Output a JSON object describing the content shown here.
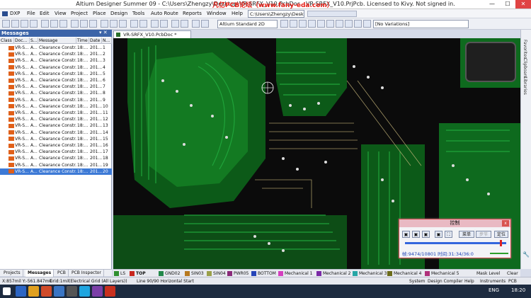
{
  "window": {
    "title": "Altium Designer Summer 09 - C:\\Users\\Zhengzy\\Desktop\\VR-SRFX_V10.PcbDoc - VR-SRFX_V10.PrjPcb. Licensed to Kivy. Not signed in.",
    "watermark": "凡亿PCB论坛（www.fany-eda.com）"
  },
  "menu": {
    "items": [
      "DXP",
      "File",
      "Edit",
      "View",
      "Project",
      "Place",
      "Design",
      "Tools",
      "Auto Route",
      "Reports",
      "Window",
      "Help"
    ],
    "path_combo": "C:\\Users\\Zhengzy\\Desktop\\VR-"
  },
  "toolbar": {
    "view_combo": "Altium Standard 2D",
    "variation_combo": "[No Variations]"
  },
  "messages": {
    "title": "Messages",
    "columns": [
      "Class",
      "Doc...",
      "S...",
      "Message",
      "Time",
      "Date",
      "N..."
    ],
    "rows": [
      {
        "doc": "VR-S...",
        "src": "A...",
        "msg": "Clearance Constr...",
        "time": "18:...",
        "date": "201...",
        "n": "1"
      },
      {
        "doc": "VR-S...",
        "src": "A...",
        "msg": "Clearance Constr...",
        "time": "18:...",
        "date": "201...",
        "n": "2"
      },
      {
        "doc": "VR-S...",
        "src": "A...",
        "msg": "Clearance Constr...",
        "time": "18:...",
        "date": "201...",
        "n": "3"
      },
      {
        "doc": "VR-S...",
        "src": "A...",
        "msg": "Clearance Constr...",
        "time": "18:...",
        "date": "201...",
        "n": "4"
      },
      {
        "doc": "VR-S...",
        "src": "A...",
        "msg": "Clearance Constr...",
        "time": "18:...",
        "date": "201...",
        "n": "5"
      },
      {
        "doc": "VR-S...",
        "src": "A...",
        "msg": "Clearance Constr...",
        "time": "18:...",
        "date": "201...",
        "n": "6"
      },
      {
        "doc": "VR-S...",
        "src": "A...",
        "msg": "Clearance Constr...",
        "time": "18:...",
        "date": "201...",
        "n": "7"
      },
      {
        "doc": "VR-S...",
        "src": "A...",
        "msg": "Clearance Constr...",
        "time": "18:...",
        "date": "201...",
        "n": "8"
      },
      {
        "doc": "VR-S...",
        "src": "A...",
        "msg": "Clearance Constr...",
        "time": "18:...",
        "date": "201...",
        "n": "9"
      },
      {
        "doc": "VR-S...",
        "src": "A...",
        "msg": "Clearance Constr...",
        "time": "18:...",
        "date": "201...",
        "n": "10"
      },
      {
        "doc": "VR-S...",
        "src": "A...",
        "msg": "Clearance Constr...",
        "time": "18:...",
        "date": "201...",
        "n": "11"
      },
      {
        "doc": "VR-S...",
        "src": "A...",
        "msg": "Clearance Constr...",
        "time": "18:...",
        "date": "201...",
        "n": "12"
      },
      {
        "doc": "VR-S...",
        "src": "A...",
        "msg": "Clearance Constr...",
        "time": "18:...",
        "date": "201...",
        "n": "13"
      },
      {
        "doc": "VR-S...",
        "src": "A...",
        "msg": "Clearance Constr...",
        "time": "18:...",
        "date": "201...",
        "n": "14"
      },
      {
        "doc": "VR-S...",
        "src": "A...",
        "msg": "Clearance Constr...",
        "time": "18:...",
        "date": "201...",
        "n": "15"
      },
      {
        "doc": "VR-S...",
        "src": "A...",
        "msg": "Clearance Constr...",
        "time": "18:...",
        "date": "201...",
        "n": "16"
      },
      {
        "doc": "VR-S...",
        "src": "A...",
        "msg": "Clearance Constr...",
        "time": "18:...",
        "date": "201...",
        "n": "17"
      },
      {
        "doc": "VR-S...",
        "src": "A...",
        "msg": "Clearance Constr...",
        "time": "18:...",
        "date": "201...",
        "n": "18"
      },
      {
        "doc": "VR-S...",
        "src": "A...",
        "msg": "Clearance Constr...",
        "time": "18:...",
        "date": "201...",
        "n": "19"
      },
      {
        "doc": "VR-S...",
        "src": "A...",
        "msg": "Clearance Constr...",
        "time": "18:...",
        "date": "201...",
        "n": "20"
      }
    ]
  },
  "panel_tabs": [
    "Projects",
    "Messages",
    "PCB",
    "PCB Inspector"
  ],
  "document_tab": "VR-SRFX_V10.PcbDoc *",
  "right_panels": [
    "Favorites",
    "Clipboard",
    "Libraries"
  ],
  "control_popup": {
    "title": "控制",
    "menu_button": "菜单",
    "step_button": "步节",
    "locate_button": "定位",
    "status": "帧:9474/10801 时间:31:34/36:0"
  },
  "layers": [
    {
      "name": "LS",
      "color": "#2f8f2f"
    },
    {
      "name": "TOP",
      "color": "#c8261e"
    },
    {
      "name": "GND02",
      "color": "#23884a"
    },
    {
      "name": "SIN03",
      "color": "#b7791f"
    },
    {
      "name": "SIN04",
      "color": "#9aa04a"
    },
    {
      "name": "PWR05",
      "color": "#8a2a7a"
    },
    {
      "name": "BOTTOM",
      "color": "#2544b8"
    },
    {
      "name": "Mechanical 1",
      "color": "#d43fbf"
    },
    {
      "name": "Mechanical 2",
      "color": "#7a2aa6"
    },
    {
      "name": "Mechanical 3",
      "color": "#26a6a6"
    },
    {
      "name": "Mechanical 4",
      "color": "#6b6b1a"
    },
    {
      "name": "Mechanical 5",
      "color": "#b0307a"
    }
  ],
  "layer_bar_right": [
    "Mask Level",
    "Clear"
  ],
  "status": {
    "coords": "X:857mil Y:-561.847mil",
    "grid": "Grid:1mil",
    "grid_mode": "(Electrical Grid (All Layers))",
    "line": "Line 90/90 Horizontal Start",
    "right_items": [
      "System",
      "Design Compiler",
      "Help",
      "Instruments",
      "PCB"
    ]
  },
  "taskbar": {
    "lang": "ENG",
    "clock": "18:20"
  }
}
